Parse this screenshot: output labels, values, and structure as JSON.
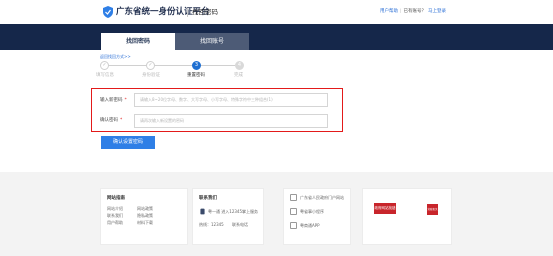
{
  "header": {
    "brand": "广东省统一身份认证平台",
    "subtitle": "找回密码",
    "links": {
      "help": "用户帮助",
      "question": "已有账号？",
      "login": "马上登录"
    }
  },
  "tabs": [
    {
      "label": "找回密码",
      "active": true
    },
    {
      "label": "找回账号",
      "active": false
    }
  ],
  "breadcrumb": "返回找回方式>>",
  "steps": [
    {
      "label": "填写信息",
      "mark": "✓",
      "state": "done"
    },
    {
      "label": "身份验证",
      "mark": "✓",
      "state": "done"
    },
    {
      "label": "重置密码",
      "mark": "3",
      "state": "current"
    },
    {
      "label": "完成",
      "mark": "4",
      "state": "todo"
    }
  ],
  "form": {
    "new_password_label": "输入新密码",
    "new_password_placeholder": "请输入8~20位字母、数字、大写字母、小写字母、特殊字符中三种组合(1)",
    "confirm_label": "确认密码",
    "confirm_placeholder": "请再次输入新设置的密码",
    "required_mark": "*",
    "submit": "确认设置密码"
  },
  "footer": {
    "guide": {
      "title": "网站指南",
      "col1": [
        "网站介绍",
        "联系我们",
        "用户帮助"
      ],
      "col2": [
        "网站政策",
        "隐私政策",
        "材料下载"
      ]
    },
    "contact": {
      "title": "联系我们",
      "line": "粤一通 进入12345掌上服务",
      "hotline_label": "热线：12345",
      "hotline_extra": "联系电话"
    },
    "apps": [
      "广东省人民政府门户网站",
      "粤省事小程序",
      "粤商通APP"
    ],
    "badges": [
      "政府网站找错",
      "党政机关"
    ]
  },
  "colors": {
    "banner": "#15274a",
    "accent": "#2f7fe6",
    "highlight": "#e31a1a"
  }
}
